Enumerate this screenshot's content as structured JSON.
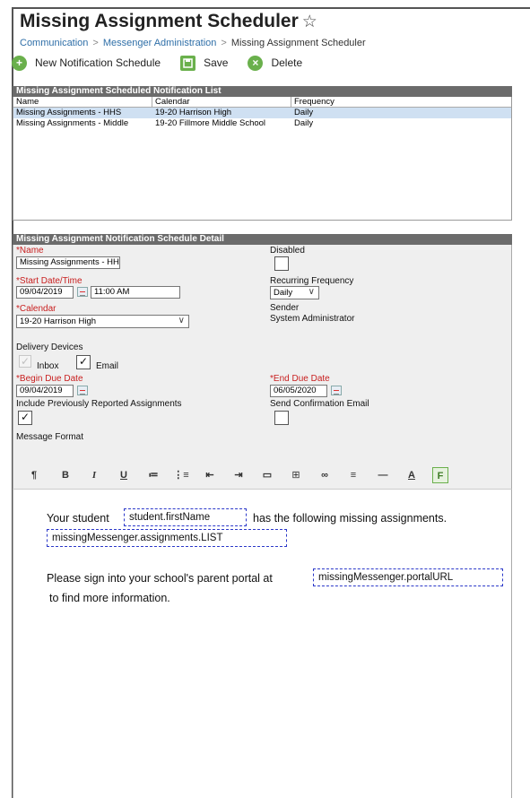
{
  "page": {
    "title": "Missing Assignment Scheduler",
    "star_icon": "☆",
    "breadcrumb": [
      "Communication",
      "Messenger Administration",
      "Missing Assignment Scheduler"
    ],
    "breadcrumb_sep": ">"
  },
  "toolbar": {
    "new_label": "New Notification Schedule",
    "save_label": "Save",
    "delete_label": "Delete",
    "icons": [
      "plus-icon",
      "save-icon",
      "delete-icon"
    ],
    "icon_color": "#6ab04c"
  },
  "list": {
    "header": "Missing Assignment Scheduled Notification List",
    "columns": [
      "Name",
      "Calendar",
      "Frequency"
    ],
    "rows": [
      {
        "name": "Missing Assignments - HHS",
        "calendar": "19-20 Harrison High",
        "frequency": "Daily"
      },
      {
        "name": "Missing Assignments - Middle",
        "calendar": "19-20 Fillmore Middle School",
        "frequency": "Daily"
      }
    ],
    "selected_color": "#cfe0f2"
  },
  "detail": {
    "header": "Missing Assignment Notification Schedule Detail",
    "required_marker": "*",
    "name_label": "Name",
    "name_value": "Missing Assignments - HHS",
    "disabled_label": "Disabled",
    "start_label": "Start Date/Time",
    "start_date": "09/04/2019",
    "start_time": "11:00 AM",
    "recurring_label": "Recurring Frequency",
    "recurring_value": "Daily",
    "calendar_label": "Calendar",
    "calendar_value": "19-20 Harrison High",
    "sender_label": "Sender",
    "sender_value": "System Administrator",
    "delivery_label": "Delivery Devices",
    "inbox_label": "Inbox",
    "email_label": "Email",
    "begin_due_label": "Begin Due Date",
    "begin_due_value": "09/04/2019",
    "end_due_label": "End Due Date",
    "end_due_value": "06/05/2020",
    "include_prev_label": "Include Previously Reported Assignments",
    "send_confirm_label": "Send Confirmation Email",
    "message_format_label": "Message Format",
    "check_mark": "✓",
    "chevron": "∨"
  },
  "format_toolbar": {
    "buttons": [
      "¶",
      "B",
      "I",
      "U",
      "≔",
      "⋮≡",
      "⇤",
      "⇥",
      "▭",
      "⊞",
      "∞",
      "≡",
      "—",
      "A",
      "F"
    ]
  },
  "message": {
    "line1_pre": "Your student",
    "token_first_name": "student.firstName",
    "line1_post": "has the following missing assignments.",
    "token_list": "missingMessenger.assignments.LIST",
    "line2_pre": "Please sign into your school's parent portal at",
    "token_portal": "missingMessenger.portalURL",
    "line3": "to find more information."
  }
}
